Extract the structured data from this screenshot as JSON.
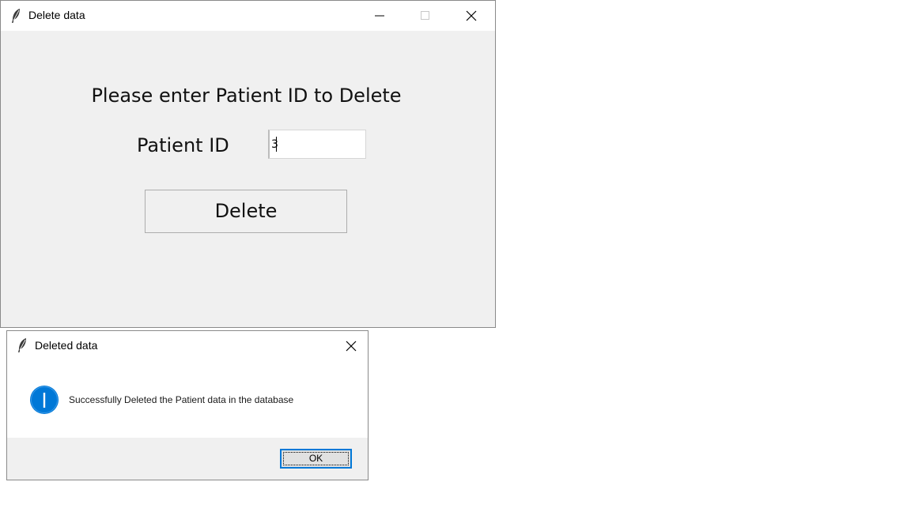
{
  "main_window": {
    "title": "Delete data",
    "heading": "Please enter Patient ID to Delete",
    "field_label": "Patient ID",
    "patient_id_value": "3",
    "delete_button": "Delete",
    "icons": {
      "app": "feather-icon",
      "minimize": "minimize-icon",
      "maximize": "maximize-icon",
      "close": "close-icon"
    }
  },
  "message_box": {
    "title": "Deleted data",
    "message": "Successfully Deleted the Patient data in the database",
    "ok_button": "OK",
    "icons": {
      "app": "feather-icon",
      "info": "info-icon",
      "close": "close-icon"
    }
  },
  "colors": {
    "window_bg": "#f0f0f0",
    "titlebar_bg": "#ffffff",
    "info_blue": "#0078d7",
    "focus_border": "#0078d7"
  }
}
